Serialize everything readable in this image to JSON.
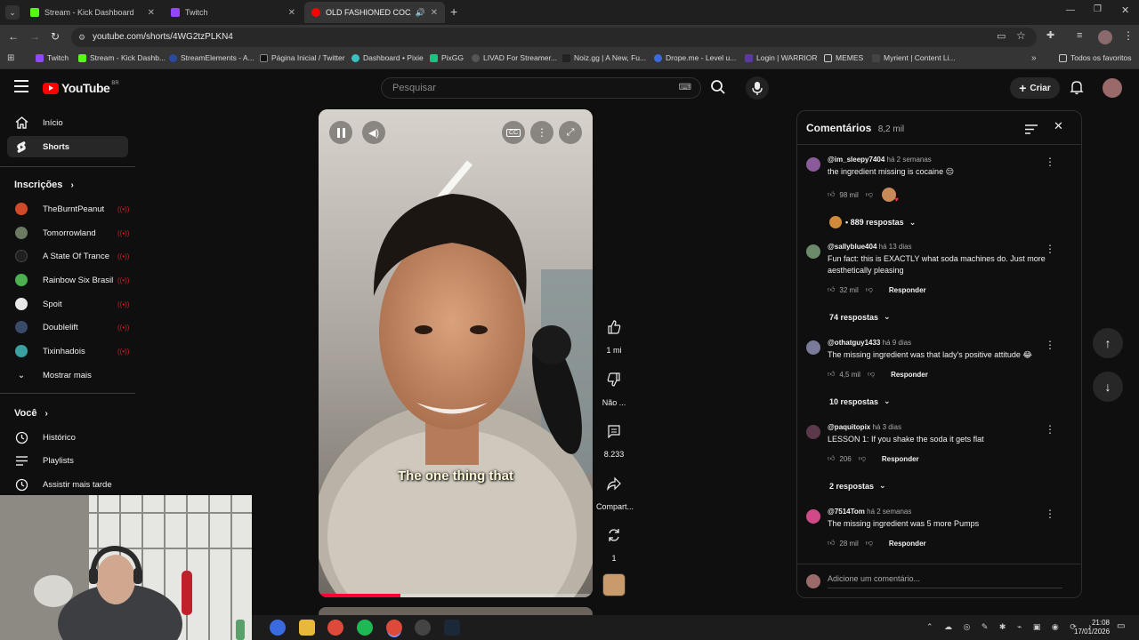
{
  "browser": {
    "tabs": [
      {
        "title": "Stream - Kick Dashboard",
        "color": "#53fc18"
      },
      {
        "title": "Twitch",
        "color": "#9146ff"
      },
      {
        "title": "OLD FASHIONED COCA-CO",
        "color": "#ff0000"
      }
    ],
    "url": "youtube.com/shorts/4WG2tzPLKN4",
    "bookmarks": [
      "Twitch",
      "Stream - Kick Dashb...",
      "StreamElements - A...",
      "Página Inicial / Twitter",
      "Dashboard • Pixie",
      "PixGG",
      "LIVAD For Streamer...",
      "Noiz.gg | A New, Fu...",
      "Drope.me - Level u...",
      "Login | WARRIOR",
      "MEMES",
      "Myrient | Content Li..."
    ],
    "all_bookmarks": "Todos os favoritos"
  },
  "youtube": {
    "logo": "YouTube",
    "region": "BR",
    "search_placeholder": "Pesquisar",
    "create_label": "Criar"
  },
  "sidebar": {
    "main": [
      {
        "label": "Início",
        "icon": "home-icon"
      },
      {
        "label": "Shorts",
        "icon": "shorts-icon"
      }
    ],
    "subscriptions_header": "Inscrições",
    "subscriptions": [
      {
        "label": "TheBurntPeanut",
        "color": "#d04a2a"
      },
      {
        "label": "Tomorrowland",
        "color": "#6b7a60"
      },
      {
        "label": "A State Of Trance",
        "color": "#202020"
      },
      {
        "label": "Rainbow Six Brasil",
        "color": "#4caf50"
      },
      {
        "label": "Spoit",
        "color": "#e8e8e8"
      },
      {
        "label": "Doublelift",
        "color": "#3a4a6a"
      },
      {
        "label": "Tixinhadois",
        "color": "#3aa0a0"
      }
    ],
    "show_more": "Mostrar mais",
    "you_header": "Você",
    "you": [
      {
        "label": "Histórico",
        "icon": "history-icon"
      },
      {
        "label": "Playlists",
        "icon": "playlist-icon"
      },
      {
        "label": "Assistir mais tarde",
        "icon": "clock-icon"
      }
    ]
  },
  "video": {
    "caption": "The one thing that",
    "progress": 0.3
  },
  "actions": {
    "likes": "1 mi",
    "dislike": "Não ...",
    "comments": "8.233",
    "share": "Compart...",
    "remix": "1"
  },
  "comments_panel": {
    "title": "Comentários",
    "count": "8,2 mil",
    "reply_label": "Responder",
    "add_placeholder": "Adicione um comentário...",
    "items": [
      {
        "user": "@im_sleepy7404",
        "time": "há 2 semanas",
        "text": "the ingredient missing is cocaine 😔",
        "likes": "98 mil",
        "replies": "• 889 respostas",
        "color": "#8a5a9a"
      },
      {
        "user": "@sallyblue404",
        "time": "há 13 dias",
        "text": "Fun fact: this is EXACTLY what soda machines do. Just more aesthetically pleasing",
        "likes": "32 mil",
        "replies": "74 respostas",
        "color": "#6a8a6a"
      },
      {
        "user": "@othatguy1433",
        "time": "há 9 dias",
        "text": "The missing ingredient was that lady's positive attitude 😂",
        "likes": "4,5 mil",
        "replies": "10 respostas",
        "color": "#7a7a9a"
      },
      {
        "user": "@paquitopix",
        "time": "há 3 dias",
        "text": "LESSON 1: If you shake the soda it gets flat",
        "likes": "206",
        "replies": "2 respostas",
        "color": "#5a3a4a"
      },
      {
        "user": "@7514Tom",
        "time": "há 2 semanas",
        "text": "The missing ingredient was 5 more Pumps",
        "likes": "28 mil",
        "replies": "",
        "color": "#d04a8a"
      }
    ]
  },
  "taskbar": {
    "time": "21:08",
    "date": "17/01/2026"
  }
}
